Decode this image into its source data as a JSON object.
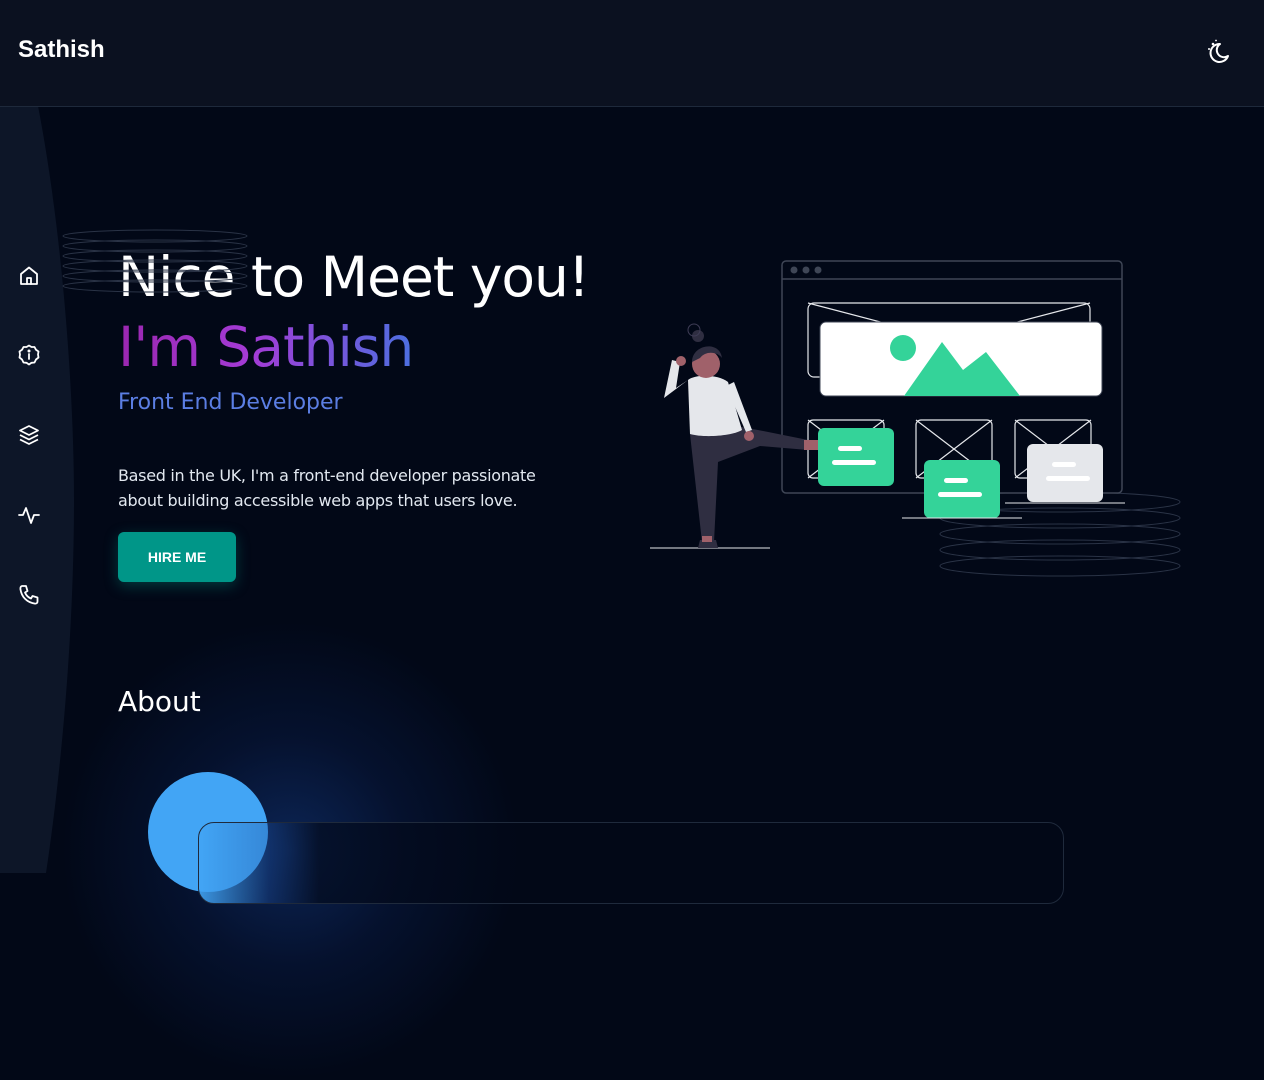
{
  "header": {
    "brand": "Sathish",
    "theme_toggle_icon": "moon-stars-icon"
  },
  "sidebar": {
    "items": [
      {
        "name": "home",
        "icon": "home-icon"
      },
      {
        "name": "about",
        "icon": "info-icon"
      },
      {
        "name": "services",
        "icon": "layers-icon"
      },
      {
        "name": "activity",
        "icon": "activity-icon"
      },
      {
        "name": "contact",
        "icon": "phone-icon"
      }
    ]
  },
  "hero": {
    "title": "Nice to Meet you!",
    "name": "I'm Sathish",
    "role": "Front End Developer",
    "description": "Based in the UK, I'm a front-end developer passionate about building accessible web apps that users love.",
    "cta_label": "HIRE ME"
  },
  "about": {
    "heading": "About"
  },
  "colors": {
    "background": "#020817",
    "header": "#0b1120",
    "accent_teal": "#009688",
    "accent_green": "#34d399",
    "role_blue": "#5b7ee3",
    "about_circle": "#42a5f5"
  }
}
